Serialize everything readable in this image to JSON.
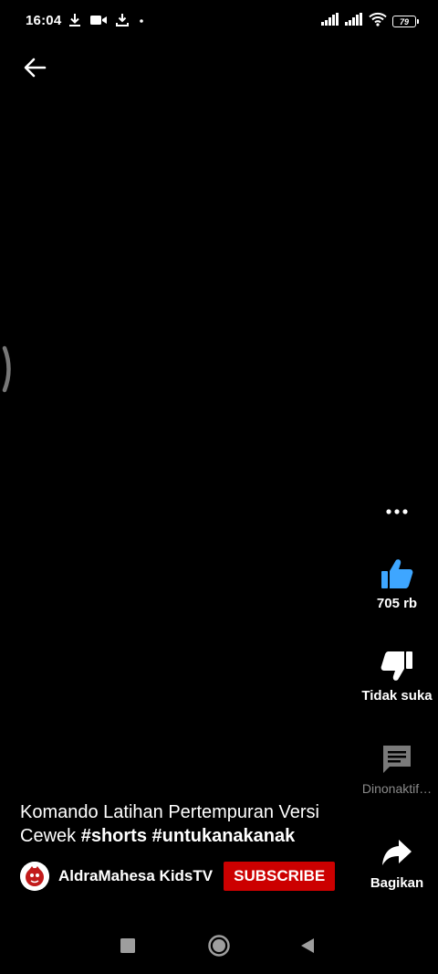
{
  "status_bar": {
    "time": "16:04",
    "battery": "79",
    "icons": [
      "download-icon",
      "video-camera-icon",
      "download-tray-icon",
      "dot-icon",
      "signal-icon",
      "signal-icon",
      "wifi-icon",
      "battery-icon"
    ]
  },
  "video": {
    "title_text": "Komando Latihan Pertempuran Versi Cewek ",
    "hashtags": [
      "#shorts",
      "#untukanakanak"
    ],
    "channel_name": "AldraMahesa KidsTV",
    "subscribe_label": "SUBSCRIBE"
  },
  "actions": {
    "like_count": "705 rb",
    "dislike_label": "Tidak suka",
    "comments_label": "Dinonaktif…",
    "share_label": "Bagikan"
  },
  "colors": {
    "like_active": "#3ea6ff",
    "subscribe_bg": "#cc0000",
    "disabled_text": "#8a8a8a"
  }
}
